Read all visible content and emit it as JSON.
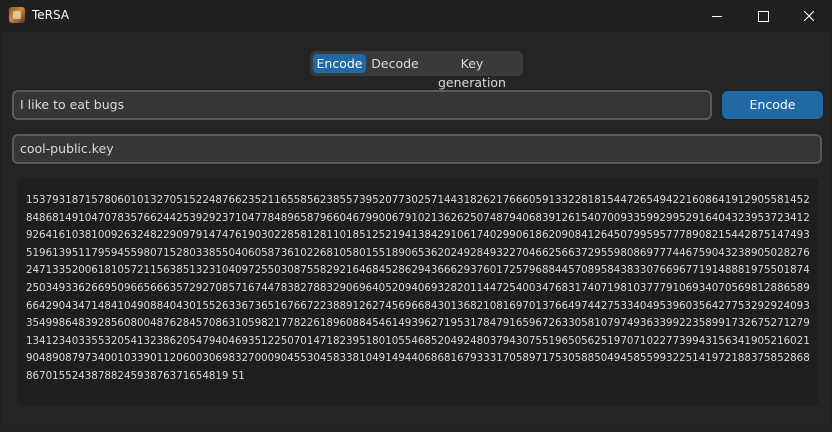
{
  "window": {
    "title": "TeRSA",
    "controls": {
      "minimize_icon": "minimize-icon",
      "maximize_icon": "maximize-icon",
      "close_icon": "close-icon"
    }
  },
  "tabs": [
    {
      "label": "Encode",
      "active": true
    },
    {
      "label": "Decode",
      "active": false
    },
    {
      "label": "Key generation",
      "active": false
    }
  ],
  "encode": {
    "message_value": "I like to eat bugs",
    "encode_button_label": "Encode",
    "key_file_value": "cool-public.key",
    "output_text": "1537931871578060101327051522487662352116558562385573952077302571443182621766605913322818154472654942216086419129055814528486814910470783576624425392923710477848965879660467990067910213626250748794068391261540700933599299529164043239537234129264161038100926324822909791474761903022858128110185125219413842910617402990618620908412645079959577789082154428751474935196139511795945598071528033855040605873610226810580155189065362024928493227046625663729559808697774467590432389050282762471335200618105721156385132310409725503087558292164684528629436662937601725796884457089584383307669677191488819755018742503493362669509665666357292708571674478382788329069640520940693282011447254003476831740719810377791069340705698128865896642904347148410490884043015526336736516766722388912627456966843013682108169701376649744275334049539603564277532929240933549986483928560800487628457086310598217782261896088454614939627195317847916596726330581079749363399223589917326752712791341234033553205413238620547940469351225070147182395180105546852049248037943075519650562519707102277399431563419052160219048908797340010339011206003069832700090455304583381049149440686816793331705897175305885049458559932251419721883758528688670155243878824593876371654819 51"
  },
  "colors": {
    "accent": "#1f6aa5",
    "window_bg": "#242424",
    "titlebar_bg": "#202020",
    "field_bg": "#343638",
    "field_border": "#565b5e",
    "output_bg": "#1d1e1e"
  }
}
